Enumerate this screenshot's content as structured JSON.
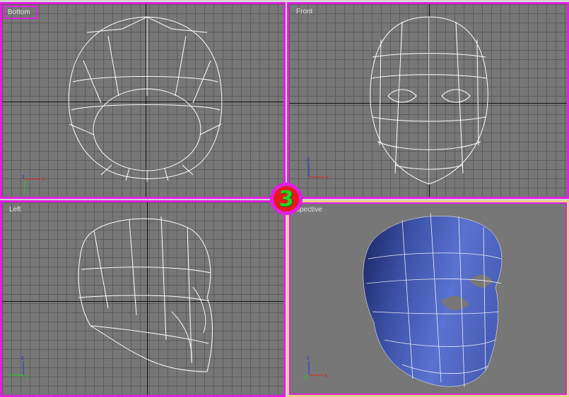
{
  "viewports": [
    {
      "key": "bottom",
      "label": "Bottom"
    },
    {
      "key": "front",
      "label": "Front"
    },
    {
      "key": "left",
      "label": "Left"
    },
    {
      "key": "perspective",
      "label": "Perspective",
      "visible_label": "spective"
    }
  ],
  "step_badge": "3",
  "axis_labels": {
    "x": "x",
    "y": "y",
    "z": "z"
  },
  "colors": {
    "border": "#e020e0",
    "active_border": "#e8cf8a",
    "viewport_bg": "#777777",
    "mesh_shaded": "#4a60b8",
    "wire": "#ffffff"
  },
  "icons": {
    "axis_tripod": "axis-tripod-icon"
  }
}
